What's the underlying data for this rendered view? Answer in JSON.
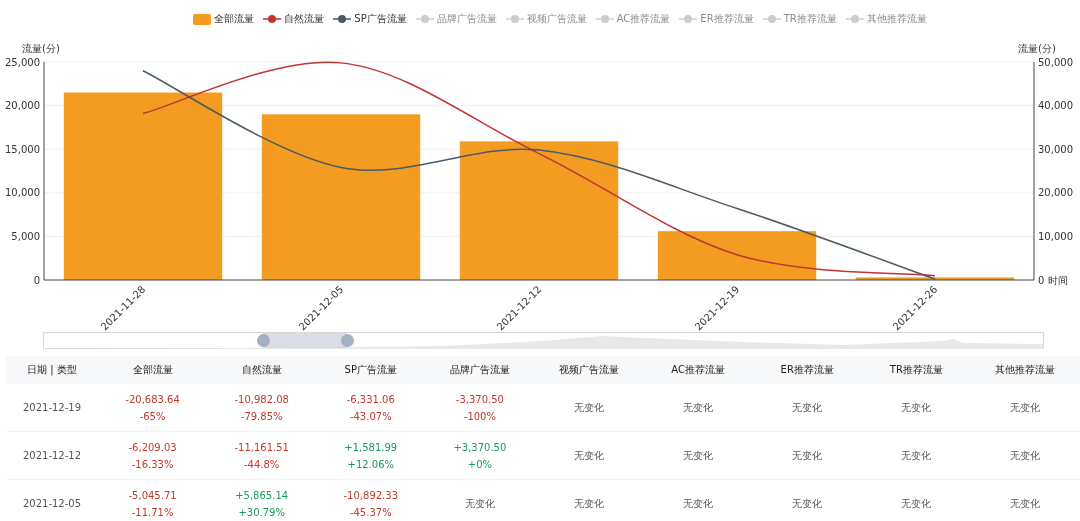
{
  "chart": {
    "legend": [
      {
        "label": "品牌广告流量",
        "selected": false
      },
      {
        "label": "视频广告流量",
        "selected": false
      },
      {
        "label": "AC推荐流量",
        "selected": false
      },
      {
        "label": "ER推荐流量",
        "selected": false
      },
      {
        "label": "TR推荐流量",
        "selected": false
      },
      {
        "label": "其他推荐流量",
        "selected": false
      }
    ],
    "chart_data": {
      "type": "bar",
      "ylabel": "流量(分)",
      "y2label": "流量(分)",
      "xlabel": "时间",
      "categories": [
        "2021-11-28",
        "2021-12-05",
        "2021-12-12",
        "2021-12-19",
        "2021-12-26"
      ],
      "ylim": [
        0,
        25000
      ],
      "yticks": [
        {
          "value": 0,
          "label": "0"
        },
        {
          "value": 5000,
          "label": "5,000"
        },
        {
          "value": 10000,
          "label": "10,000"
        },
        {
          "value": 15000,
          "label": "15,000"
        },
        {
          "value": 20000,
          "label": "20,000"
        },
        {
          "value": 25000,
          "label": "25,000"
        }
      ],
      "y2lim": [
        0,
        50000
      ],
      "grid": true,
      "y2ticks": [
        {
          "value": 0,
          "label": "0"
        },
        {
          "value": 10000,
          "label": "10,000"
        },
        {
          "value": 20000,
          "label": "20,000"
        },
        {
          "value": 30000,
          "label": "30,000"
        },
        {
          "value": 40000,
          "label": "40,000"
        },
        {
          "value": 50000,
          "label": "50,000"
        }
      ],
      "series": [
        {
          "name": "全部流量",
          "color": "#f39c21",
          "values": [
            21500,
            19000,
            15900,
            5600,
            300
          ]
        },
        {
          "name": "自然流量",
          "type": "line",
          "color": "#c23531",
          "values": [
            19100,
            24900,
            14500,
            2900,
            500
          ]
        },
        {
          "name": "SP广告流量",
          "type": "line",
          "color": "#4a5a66",
          "values": [
            24000,
            12900,
            14900,
            8200,
            100
          ]
        }
      ]
    }
  },
  "zoom_slider": {
    "handles": [
      {
        "level": 0.22
      },
      {
        "level": 0.304
      }
    ]
  },
  "table": {
    "columns": [
      "日期 | 类型",
      "全部流量",
      "自然流量",
      "SP广告流量",
      "品牌广告流量",
      "视频广告流量",
      "AC推荐流量",
      "ER推荐流量",
      "TR推荐流量",
      "其他推荐流量"
    ],
    "rows": [
      {
        "cells": [
          {
            "kind": "date",
            "value": "2021-12-19"
          },
          {
            "kind": "down",
            "value": "-20,683.64",
            "pct": "-65%"
          },
          {
            "kind": "down",
            "value": "-10,982.08",
            "pct": "-79.85%"
          },
          {
            "kind": "down",
            "value": "-6,331.06",
            "pct": "-43.07%"
          },
          {
            "kind": "down",
            "value": "-3,370.50",
            "pct": "-100%"
          },
          {
            "kind": "none",
            "value": "无变化"
          },
          {
            "kind": "none",
            "value": "无变化"
          },
          {
            "kind": "none",
            "value": "无变化"
          },
          {
            "kind": "none",
            "value": "无变化"
          },
          {
            "kind": "none",
            "value": "无变化"
          }
        ]
      },
      {
        "cells": [
          {
            "kind": "date",
            "value": "2021-12-12"
          },
          {
            "kind": "down",
            "value": "-6,209.03",
            "pct": "-16.33%"
          },
          {
            "kind": "down",
            "value": "-11,161.51",
            "pct": "-44.8%"
          },
          {
            "kind": "up",
            "value": "+1,581.99",
            "pct": "+12.06%"
          },
          {
            "kind": "up",
            "value": "+3,370.50",
            "pct": "+0%"
          },
          {
            "kind": "none",
            "value": "无变化"
          },
          {
            "kind": "none",
            "value": "无变化"
          },
          {
            "kind": "none",
            "value": "无变化"
          },
          {
            "kind": "none",
            "value": "无变化"
          },
          {
            "kind": "none",
            "value": "无变化"
          }
        ]
      },
      {
        "cells": [
          {
            "kind": "date",
            "value": "2021-12-05"
          },
          {
            "kind": "down",
            "value": "-5,045.71",
            "pct": "-11.71%"
          },
          {
            "kind": "up",
            "value": "+5,865.14",
            "pct": "+30.79%"
          },
          {
            "kind": "down",
            "value": "-10,892.33",
            "pct": "-45.37%"
          },
          {
            "kind": "none",
            "value": "无变化"
          },
          {
            "kind": "none",
            "value": "无变化"
          },
          {
            "kind": "none",
            "value": "无变化"
          },
          {
            "kind": "none",
            "value": "无变化"
          },
          {
            "kind": "none",
            "value": "无变化"
          },
          {
            "kind": "none",
            "value": "无变化"
          }
        ]
      }
    ]
  }
}
